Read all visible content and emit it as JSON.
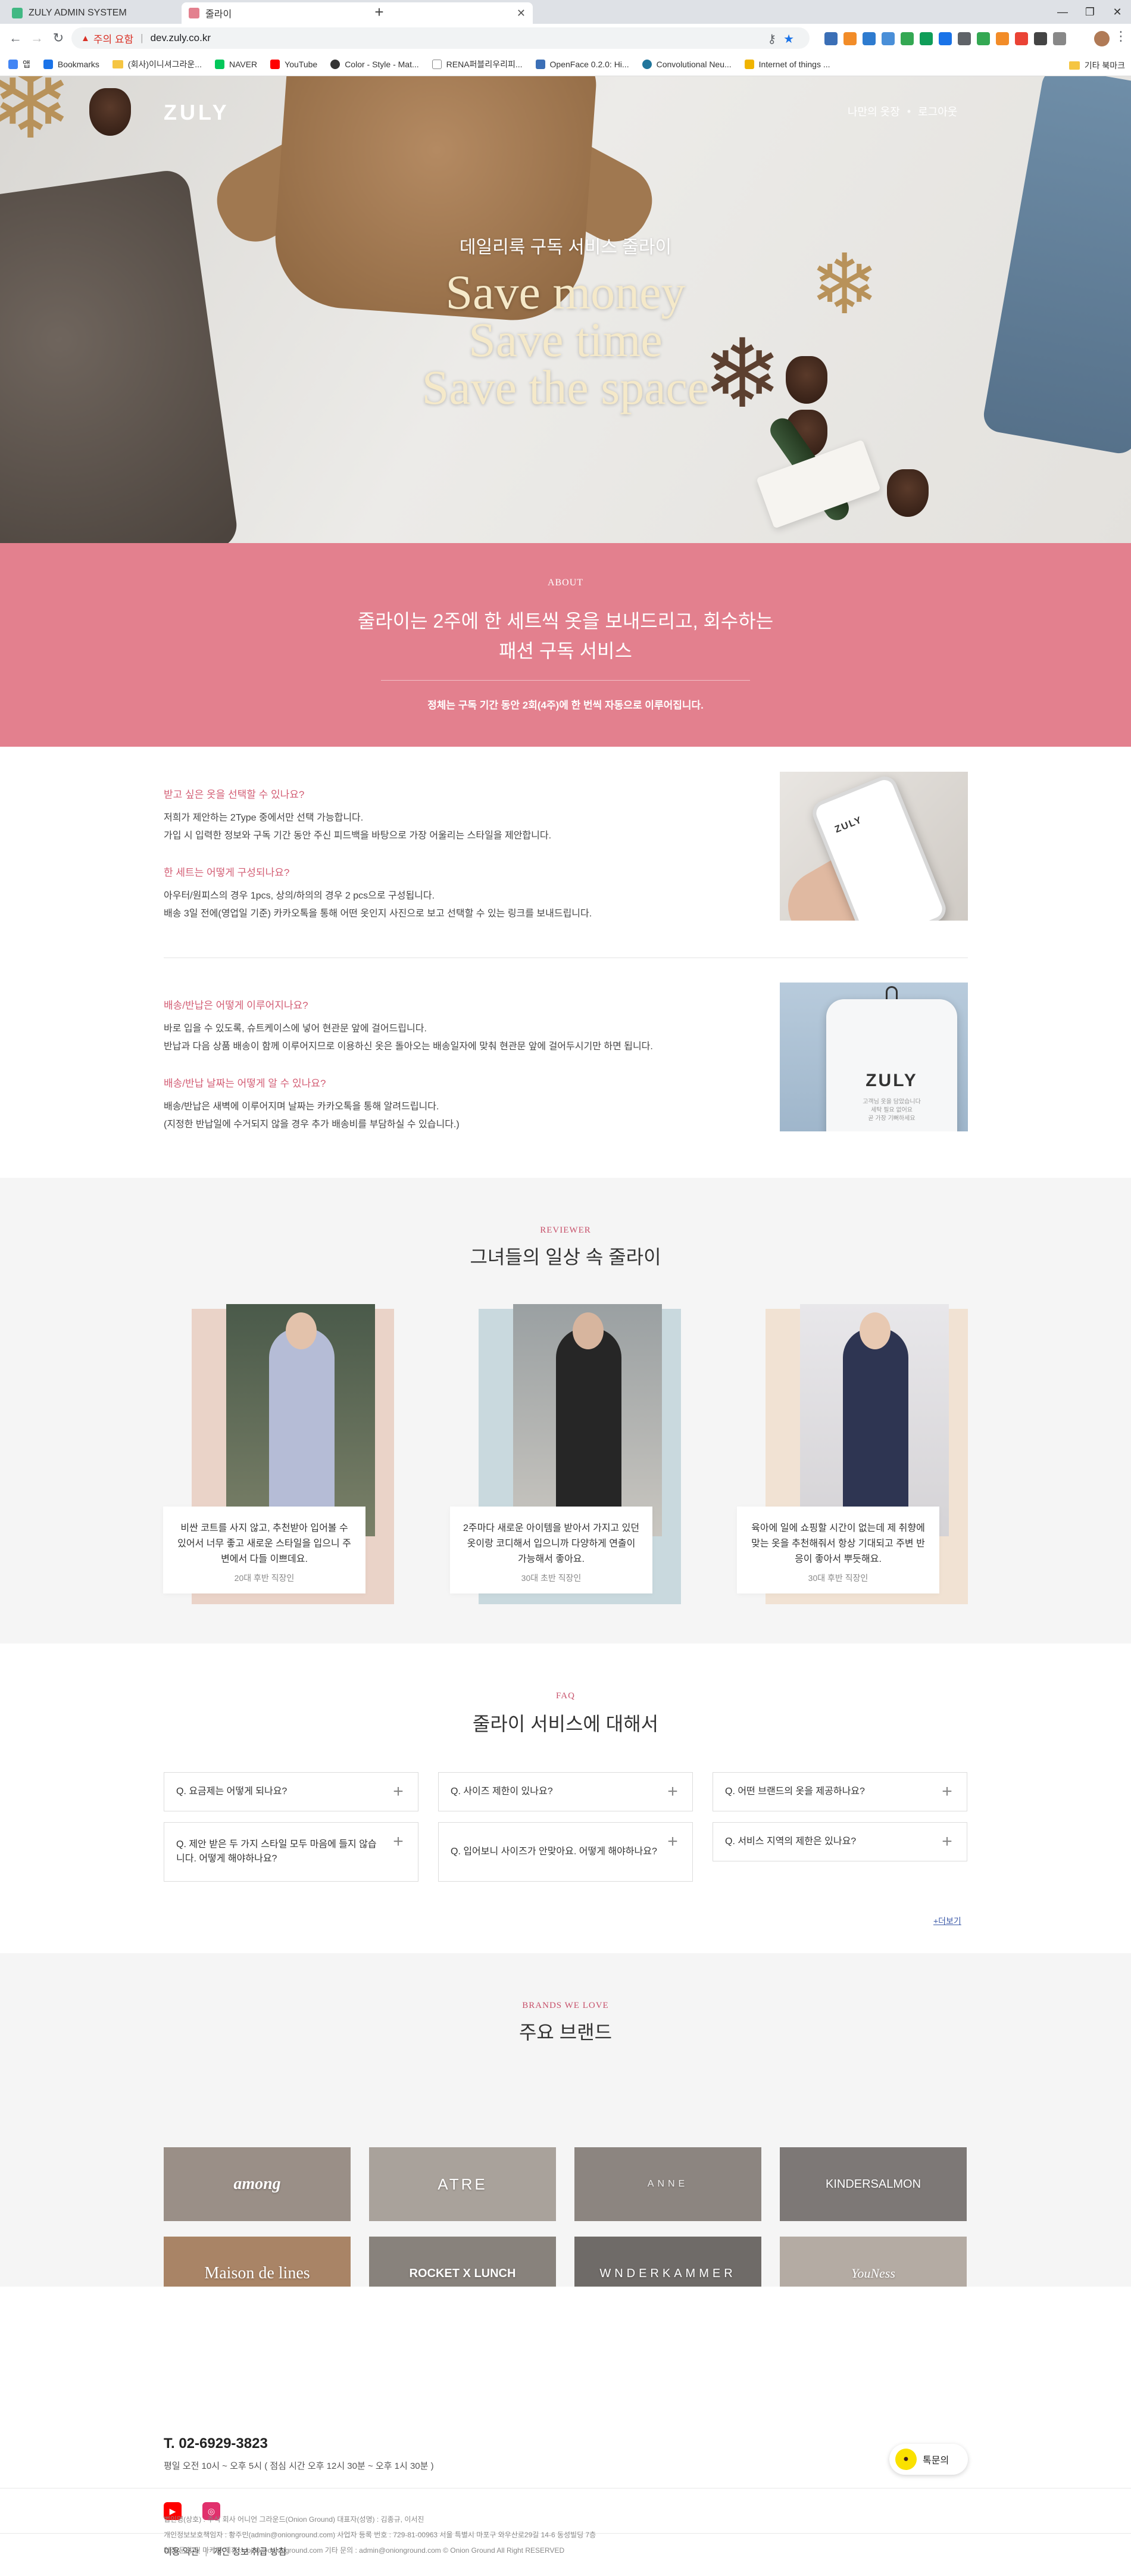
{
  "browser": {
    "tabs": [
      {
        "title": "ZULY ADMIN SYSTEM",
        "active": false,
        "favicon_color": "#41b883"
      },
      {
        "title": "줄라이",
        "active": true,
        "favicon_color": "#e3808e"
      }
    ],
    "new_tab": "+",
    "window_controls": [
      "—",
      "❐",
      "✕"
    ],
    "address": {
      "security_label": "주의 요함",
      "url": "dev.zuly.co.kr"
    },
    "bookmarks": [
      {
        "label": "앱",
        "icon": "apps-icon",
        "color": "#4285f4"
      },
      {
        "label": "Bookmarks",
        "icon": "star-icon",
        "color": "#1a73e8"
      },
      {
        "label": "(회사)이니셔그라운...",
        "icon": "folder-icon",
        "color": "#f5c542"
      },
      {
        "label": "NAVER",
        "icon": "naver-icon",
        "color": "#03c75a"
      },
      {
        "label": "YouTube",
        "icon": "youtube-icon",
        "color": "#ff0000"
      },
      {
        "label": "Color - Style - Mat...",
        "icon": "github-icon",
        "color": "#333333"
      },
      {
        "label": "RENA퍼블리우리피...",
        "icon": "doc-icon",
        "color": "#888888"
      },
      {
        "label": "OpenFace 0.2.0: Hi...",
        "icon": "openface-icon",
        "color": "#3b6fb6"
      },
      {
        "label": "Convolutional Neu...",
        "icon": "wordpress-icon",
        "color": "#21759b"
      },
      {
        "label": "Internet of things ...",
        "icon": "tri-icon",
        "color": "#f0b400"
      }
    ],
    "bookmarks_other": "기타 북마크"
  },
  "site": {
    "logo": "ZULY",
    "nav": {
      "my_closet": "나만의 옷장",
      "separator": "•",
      "logout": "로그아웃"
    }
  },
  "hero": {
    "subtitle": "데일리룩 구독 서비스 줄라이",
    "lines": [
      "Save money",
      "Save time",
      "Save the space"
    ]
  },
  "about": {
    "label": "ABOUT",
    "title_line1": "줄라이는 2주에 한 세트씩 옷을 보내드리고, 회수하는",
    "title_line2": "패션 구독 서비스",
    "note": "정체는 구독 기간 동안 2회(4주)에 한 번씩 자동으로 이루어집니다."
  },
  "info": {
    "qa": [
      {
        "q": "받고 싶은 옷을 선택할 수 있나요?",
        "a": [
          "저희가 제안하는 2Type 중에서만 선택 가능합니다.",
          "가입 시 입력한 정보와 구독 기간 동안 주신 피드백을 바탕으로 가장 어울리는 스타일을 제안합니다."
        ]
      },
      {
        "q": "한 세트는 어떻게 구성되나요?",
        "a": [
          "아우터/원피스의 경우 1pcs, 상의/하의의 경우 2 pcs으로 구성됩니다.",
          "배송 3일 전에(영업일 기준) 카카오톡을 통해 어떤 옷인지 사진으로 보고 선택할 수 있는 링크를 보내드립니다."
        ]
      },
      {
        "q": "배송/반납은 어떻게 이루어지나요?",
        "a": [
          "바로 입을 수 있도록, 슈트케이스에 넣어 현관문 앞에 걸어드립니다.",
          "반납과 다음 상품 배송이 함께 이루어지므로 이용하신 옷은 돌아오는 배송일자에 맞춰 현관문 앞에 걸어두시기만 하면 됩니다."
        ]
      },
      {
        "q": "배송/반납 날짜는 어떻게 알 수 있나요?",
        "a": [
          "배송/반납은 새벽에 이루어지며 날짜는 카카오톡을 통해 알려드립니다.",
          "(지정한 반납일에 수거되지 않을 경우 추가 배송비를 부담하실 수 있습니다.)"
        ]
      }
    ],
    "phone_logo": "ZULY",
    "bag_logo": "ZULY",
    "bag_text": "고객님 옷을 담았습니다\n세탁 필요 없어요\n곧 가장 기뻐하세요"
  },
  "reviewer": {
    "label": "REVIEWER",
    "title": "그녀들의 일상 속 줄라이",
    "cards": [
      {
        "text": "비싼 코트를 사지 않고, 추천받아 입어볼 수 있어서 너무 좋고 새로운 스타일을 입으니 주변에서 다들 이쁘데요.",
        "who": "20대 후반 직장인",
        "bg": "#ead3c8",
        "coat": "#b5bcd6"
      },
      {
        "text": "2주마다 새로운 아이템을 받아서 가지고 있던 옷이랑 코디해서 입으니까 다양하게 연출이 가능해서 좋아요.",
        "who": "30대 초반 직장인",
        "bg": "#c9d9de",
        "coat": "#262626"
      },
      {
        "text": "육아에 일에 쇼핑할 시간이 없는데 제 취향에 맞는 옷을 추천해줘서 항상 기대되고 주변 반응이 좋아서 뿌듯해요.",
        "who": "30대 후반 직장인",
        "bg": "#f1e2d3",
        "coat": "#2e3552"
      }
    ]
  },
  "faq": {
    "label": "FAQ",
    "title": "줄라이 서비스에 대해서",
    "items": [
      "Q. 요금제는 어떻게 되나요?",
      "Q. 사이즈 제한이 있나요?",
      "Q. 어떤 브랜드의 옷을 제공하나요?",
      "Q. 제안 받은 두 가지 스타일 모두 마음에 들지 않습니다. 어떻게 해야하나요?",
      "Q. 입어보니 사이즈가 안맞아요. 어떻게 해야하나요?",
      "Q. 서비스 지역의 제한은 있나요?"
    ],
    "more": "+더보기"
  },
  "brands": {
    "label": "BRANDS WE LOVE",
    "title": "주요 브랜드",
    "items": [
      {
        "name": "among",
        "bg": "#9a8f87"
      },
      {
        "name": "ATRE",
        "bg": "#a9a29b"
      },
      {
        "name": "ANNE",
        "bg": "#8c8580"
      },
      {
        "name": "KINDERSALMON",
        "bg": "#7d7876"
      },
      {
        "name": "Maison de lines",
        "bg": "#a98466"
      },
      {
        "name": "ROCKET X LUNCH",
        "bg": "#88827c"
      },
      {
        "name": "WNDERKAMMER",
        "bg": "#6f6b68"
      },
      {
        "name": "YouNess",
        "bg": "#b4aba3"
      }
    ]
  },
  "footer": {
    "phone": "T. 02-6929-3823",
    "hours": "평일 오전 10시 ~ 오후 5시 ( 점심 시간 오후 12시 30분 ~ 오후 1시 30분 )",
    "talk": "톡문의",
    "links": [
      "이용 약관",
      "개인 정보 취급 방침"
    ],
    "legal": [
      "법인명(상호) : 주식 회사 어니언 그라운드(Onion Ground) 대표자(성명) : 김종규, 이서진",
      "개인정보보호책임자 : 황주민(admin@onionground.com) 사업자 등록 번호 : 729-81-00963 서울 특별시 마포구 와우산로29길 14-6 동성빌딩 7층",
      "업점 문의 및 마케팅 제휴 : cpj00@onionground.com 기타 문의 : admin@onionground.com © Onion Ground All Right RESERVED"
    ]
  },
  "colors": {
    "accent_pink": "#e3808e",
    "question_pink": "#d35d74",
    "kakao_yellow": "#fae100",
    "youtube_red": "#ff0000",
    "instagram_pink": "#e1306c"
  }
}
